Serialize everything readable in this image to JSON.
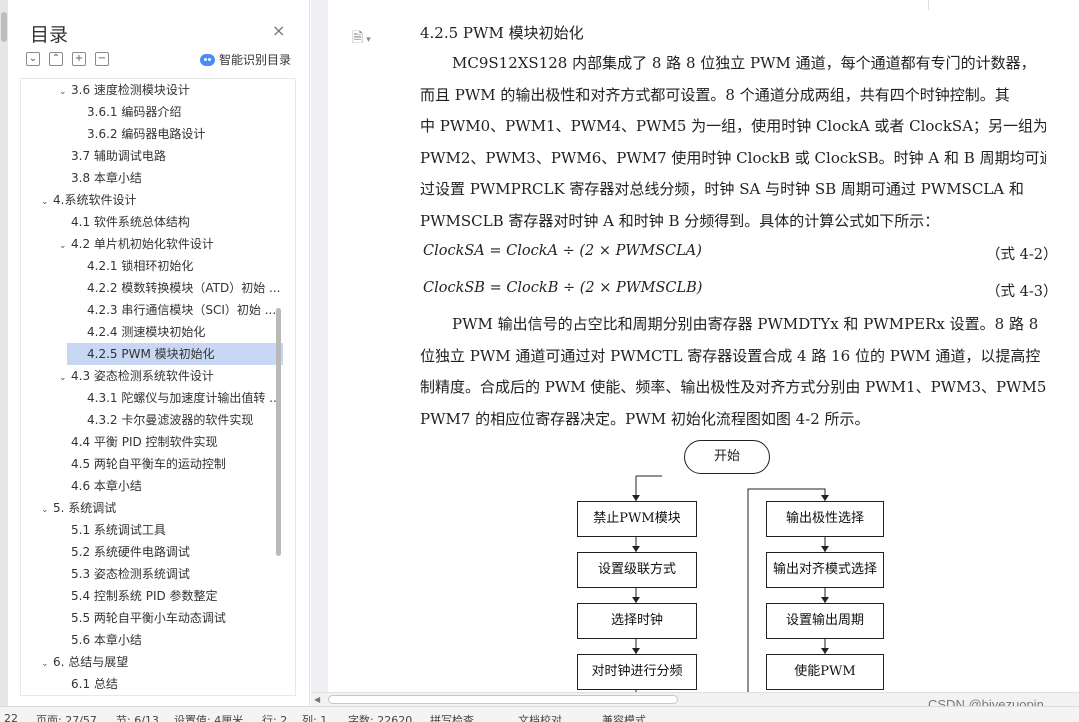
{
  "toc": {
    "title": "目录",
    "close": "×",
    "tools": [
      "⌄",
      "⌃",
      "+",
      "−"
    ],
    "ai_label": "智能识别目录",
    "items": [
      {
        "text": "3.6 速度检测模块设计",
        "arrow": "⌄"
      },
      {
        "text": "3.6.1 编码器介绍",
        "arrow": ""
      },
      {
        "text": "3.6.2  编码器电路设计",
        "arrow": ""
      },
      {
        "text": "3.7 辅助调试电路",
        "arrow": ""
      },
      {
        "text": "3.8 本章小结",
        "arrow": ""
      },
      {
        "text": "4.系统软件设计",
        "arrow": "⌄"
      },
      {
        "text": "4.1 软件系统总体结构",
        "arrow": ""
      },
      {
        "text": "4.2 单片机初始化软件设计",
        "arrow": "⌄"
      },
      {
        "text": "4.2.1 锁相环初始化",
        "arrow": ""
      },
      {
        "text": "4.2.2 模数转换模块（ATD）初始 ...",
        "arrow": ""
      },
      {
        "text": "4.2.3 串行通信模块（SCI）初始 ...",
        "arrow": ""
      },
      {
        "text": "4.2.4 测速模块初始化",
        "arrow": ""
      },
      {
        "text": "4.2.5 PWM 模块初始化",
        "arrow": ""
      },
      {
        "text": "4.3 姿态检测系统软件设计",
        "arrow": "⌄"
      },
      {
        "text": "4.3.1 陀螺仪与加速度计输出值转 ...",
        "arrow": ""
      },
      {
        "text": "4.3.2  卡尔曼滤波器的软件实现",
        "arrow": ""
      },
      {
        "text": "4.4 平衡 PID 控制软件实现",
        "arrow": ""
      },
      {
        "text": "4.5 两轮自平衡车的运动控制",
        "arrow": ""
      },
      {
        "text": "4.6 本章小结",
        "arrow": ""
      },
      {
        "text": "5.  系统调试",
        "arrow": "⌄"
      },
      {
        "text": "5.1 系统调试工具",
        "arrow": ""
      },
      {
        "text": "5.2 系统硬件电路调试",
        "arrow": ""
      },
      {
        "text": "5.3 姿态检测系统调试",
        "arrow": ""
      },
      {
        "text": "5.4 控制系统 PID 参数整定",
        "arrow": ""
      },
      {
        "text": "5.5 两轮自平衡小车动态调试",
        "arrow": ""
      },
      {
        "text": "5.6 本章小结",
        "arrow": ""
      },
      {
        "text": "6.  总结与展望",
        "arrow": "⌄"
      },
      {
        "text": "6.1  总结",
        "arrow": ""
      }
    ]
  },
  "doc": {
    "heading": "4.2.5 PWM 模块初始化",
    "para1": [
      "MC9S12XS128 内部集成了 8 路 8 位独立 PWM 通道，每个通道都有专门的计数器，",
      "而且 PWM 的输出极性和对齐方式都可设置。8 个通道分成两组，共有四个时钟控制。其",
      "中 PWM0、PWM1、PWM4、PWM5 为一组，使用时钟 ClockA 或者 ClockSA；另一组为",
      "PWM2、PWM3、PWM6、PWM7 使用时钟 ClockB 或 ClockSB。时钟 A 和 B 周期均可通",
      "过设置 PWMPRCLK 寄存器对总线分频，时钟 SA 与时钟 SB 周期可通过 PWMSCLA 和",
      "PWMSCLB 寄存器对时钟 A 和时钟 B 分频得到。具体的计算公式如下所示："
    ],
    "formula1": "ClockSA = ClockA ÷ (2 × PWMSCLA)",
    "eq1": "（式 4-2）",
    "formula2": "ClockSB = ClockB ÷ (2 × PWMSCLB)",
    "eq2": "（式 4-3）",
    "para2": [
      "PWM 输出信号的占空比和周期分别由寄存器 PWMDTYx 和 PWMPERx 设置。8 路 8",
      "位独立 PWM 通道可通过对 PWMCTL 寄存器设置合成 4 路 16 位的 PWM 通道，以提高控",
      "制精度。合成后的 PWM 使能、频率、输出极性及对齐方式分别由 PWM1、PWM3、PWM5、",
      "PWM7 的相应位寄存器决定。PWM 初始化流程图如图 4-2 所示。"
    ]
  },
  "flow": {
    "start": "开始",
    "left": [
      "禁止PWM模块",
      "设置级联方式",
      "选择时钟",
      "对时钟进行分频"
    ],
    "right": [
      "输出极性选择",
      "输出对齐模式选择",
      "设置输出周期",
      "使能PWM"
    ]
  },
  "status": {
    "page_num": "22",
    "page": "页面: 27/57",
    "section": "节: 6/13",
    "setting": "设置值: 4厘米",
    "row": "行: 2",
    "col": "列: 1",
    "words": "字数: 22620",
    "spell": "拼写检查",
    "proof": "文档校对",
    "compat": "兼容模式"
  },
  "watermark": "CSDN @biyezuopin"
}
